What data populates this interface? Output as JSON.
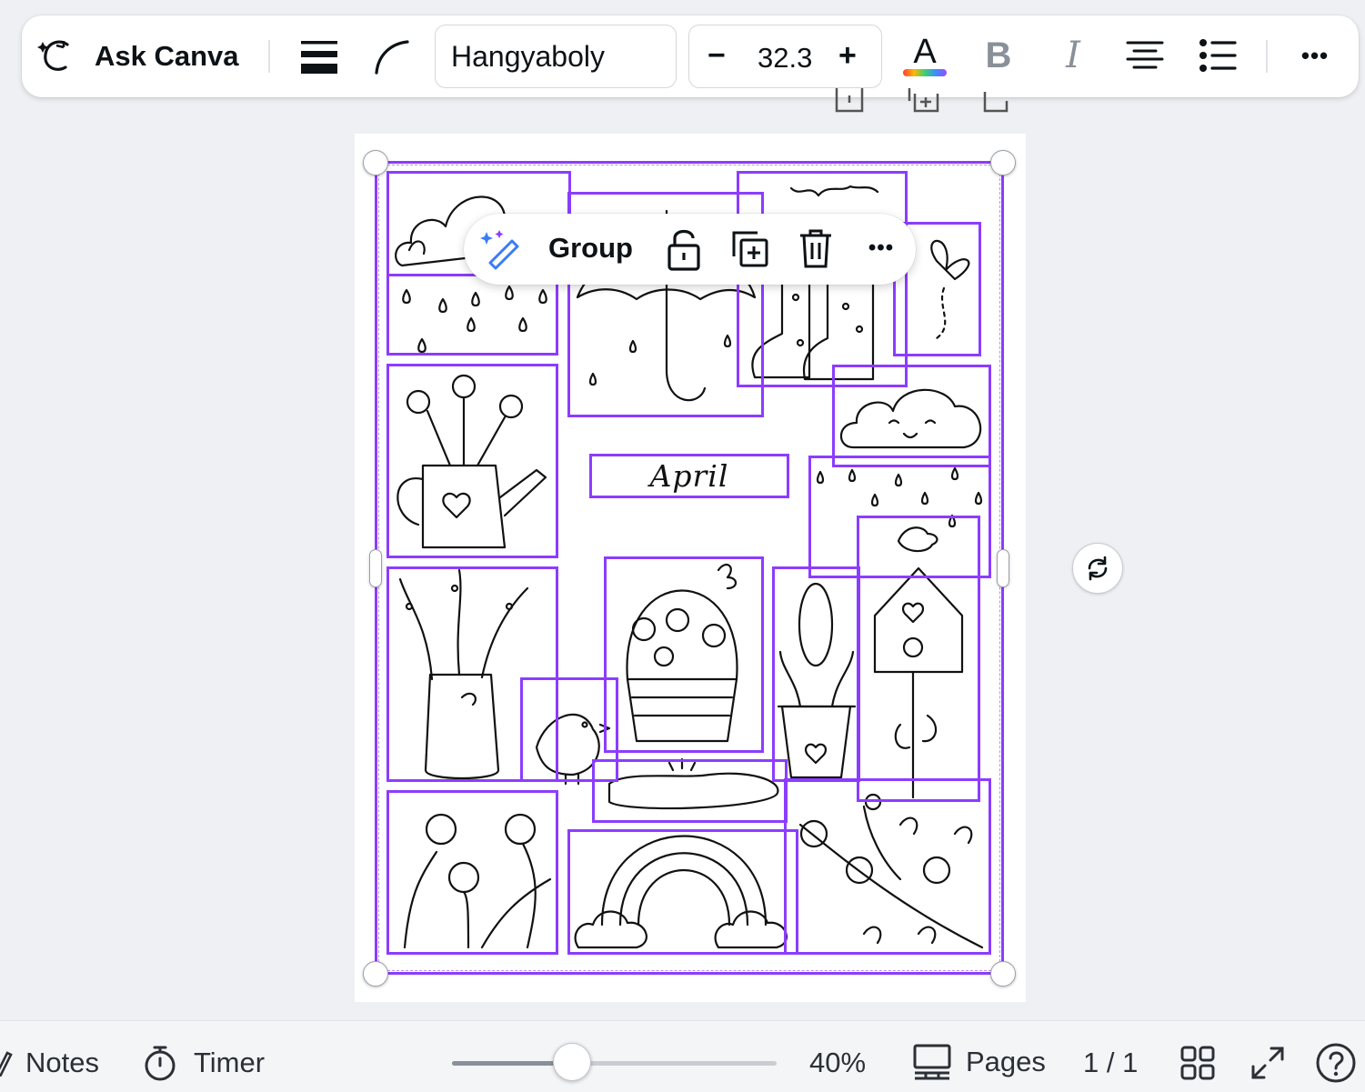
{
  "toolbar": {
    "ask_label": "Ask Canva",
    "font_name": "Hangyaboly",
    "font_size": "32.3",
    "minus_label": "−",
    "plus_label": "+",
    "text_color_letter": "A",
    "bold_letter": "B",
    "italic_letter": "I",
    "more_label": "•••"
  },
  "canvas": {
    "title_text": "April",
    "accent_color": "#8b3dff"
  },
  "group_menu": {
    "group_label": "Group",
    "more_label": "•••"
  },
  "bottombar": {
    "notes_label": "Notes",
    "timer_label": "Timer",
    "zoom_percent": "40%",
    "zoom_fraction": 0.37,
    "pages_label": "Pages",
    "page_count": "1 / 1"
  }
}
